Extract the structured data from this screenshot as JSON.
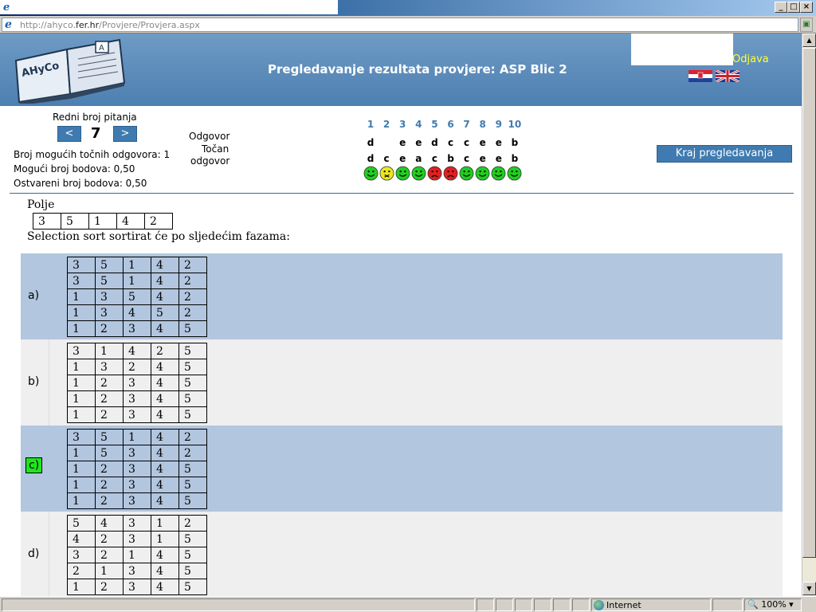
{
  "browser": {
    "url_prefix": "http://ahyco.",
    "url_domain": "fer.hr",
    "url_path": "/Provjere/Provjera.aspx",
    "status_zone": "Internet",
    "zoom": "100%"
  },
  "header": {
    "logo_text": "AHyCo",
    "title": "Pregledavanje rezultata provjere: ASP Blic 2",
    "logout": "Odjava"
  },
  "nav": {
    "question_label": "Redni broj pitanja",
    "prev": "<",
    "next": ">",
    "current": "7",
    "possible_correct": "Broj mogućih točnih odgovora: 1",
    "possible_points": "Mogući broj bodova: 0,50",
    "achieved_points": "Ostvareni broj bodova: 0,50",
    "answer_label": "Odgovor",
    "correct_label_1": "Točan",
    "correct_label_2": "odgovor",
    "end_button": "Kraj pregledavanja"
  },
  "results": {
    "numbers": [
      "1",
      "2",
      "3",
      "4",
      "5",
      "6",
      "7",
      "8",
      "9",
      "10"
    ],
    "answers": [
      "d",
      "",
      "e",
      "e",
      "d",
      "c",
      "c",
      "e",
      "e",
      "b"
    ],
    "correct": [
      "d",
      "c",
      "e",
      "a",
      "c",
      "b",
      "c",
      "e",
      "e",
      "b"
    ],
    "status": [
      "happy",
      "neutral",
      "happy",
      "happy",
      "sad",
      "sad",
      "happy",
      "happy",
      "happy",
      "happy"
    ],
    "colors": {
      "happy": "#22cc22",
      "neutral": "#e8e820",
      "sad": "#e02020"
    }
  },
  "question": {
    "field_label": "Polje",
    "field": [
      "3",
      "5",
      "1",
      "4",
      "2"
    ],
    "text": "Selection sort sortirat će po sljedećim fazama:"
  },
  "options": [
    {
      "letter": "a)",
      "rows": [
        [
          "3",
          "5",
          "1",
          "4",
          "2"
        ],
        [
          "3",
          "5",
          "1",
          "4",
          "2"
        ],
        [
          "1",
          "3",
          "5",
          "4",
          "2"
        ],
        [
          "1",
          "3",
          "4",
          "5",
          "2"
        ],
        [
          "1",
          "2",
          "3",
          "4",
          "5"
        ]
      ]
    },
    {
      "letter": "b)",
      "rows": [
        [
          "3",
          "1",
          "4",
          "2",
          "5"
        ],
        [
          "1",
          "3",
          "2",
          "4",
          "5"
        ],
        [
          "1",
          "2",
          "3",
          "4",
          "5"
        ],
        [
          "1",
          "2",
          "3",
          "4",
          "5"
        ],
        [
          "1",
          "2",
          "3",
          "4",
          "5"
        ]
      ]
    },
    {
      "letter": "c)",
      "rows": [
        [
          "3",
          "5",
          "1",
          "4",
          "2"
        ],
        [
          "1",
          "5",
          "3",
          "4",
          "2"
        ],
        [
          "1",
          "2",
          "3",
          "4",
          "5"
        ],
        [
          "1",
          "2",
          "3",
          "4",
          "5"
        ],
        [
          "1",
          "2",
          "3",
          "4",
          "5"
        ]
      ]
    },
    {
      "letter": "d)",
      "rows": [
        [
          "5",
          "4",
          "3",
          "1",
          "2"
        ],
        [
          "4",
          "2",
          "3",
          "1",
          "5"
        ],
        [
          "3",
          "2",
          "1",
          "4",
          "5"
        ],
        [
          "2",
          "1",
          "3",
          "4",
          "5"
        ],
        [
          "1",
          "2",
          "3",
          "4",
          "5"
        ]
      ]
    }
  ]
}
